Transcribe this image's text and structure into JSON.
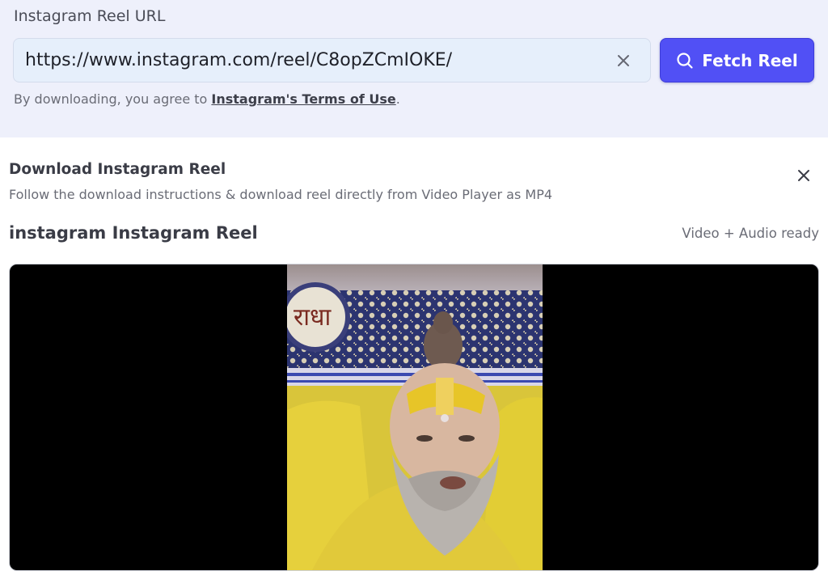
{
  "url_form": {
    "label": "Instagram Reel URL",
    "input_value": "https://www.instagram.com/reel/C8opZCmIOKE/",
    "fetch_label": "Fetch Reel",
    "terms_prefix": "By downloading, you agree to ",
    "terms_link": "Instagram's Terms of Use",
    "terms_suffix": "."
  },
  "download": {
    "title": "Download Instagram Reel",
    "subtitle": "Follow the download instructions & download reel directly from Video Player as MP4",
    "reel_title": "instagram Instagram Reel",
    "status": "Video + Audio ready"
  },
  "colors": {
    "accent": "#5150f5",
    "panel_bg": "#eef0fb",
    "input_bg": "#e6effb"
  },
  "icons": {
    "clear": "close-icon",
    "fetch": "search-icon",
    "dismiss": "close-icon"
  }
}
